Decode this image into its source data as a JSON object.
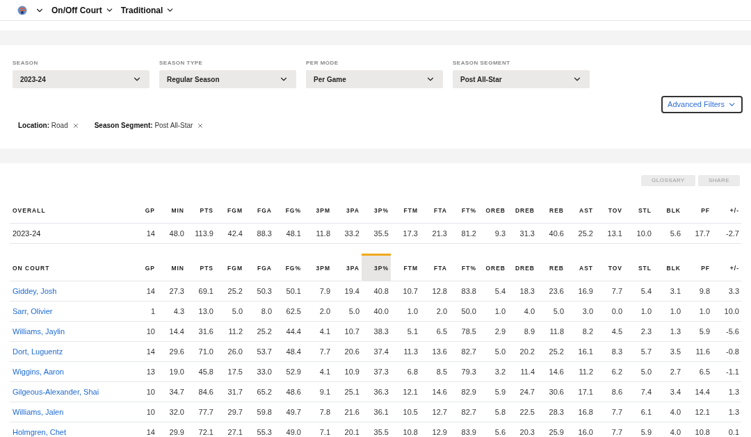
{
  "nav": {
    "items": [
      {
        "label": "On/Off Court"
      },
      {
        "label": "Traditional"
      }
    ]
  },
  "filters": {
    "dropdowns": [
      {
        "label": "SEASON",
        "value": "2023-24"
      },
      {
        "label": "SEASON TYPE",
        "value": "Regular Season"
      },
      {
        "label": "PER MODE",
        "value": "Per Game"
      },
      {
        "label": "SEASON SEGMENT",
        "value": "Post All-Star"
      }
    ],
    "advanced_button": "Advanced Filters",
    "tags": [
      {
        "label": "Location:",
        "value": "Road"
      },
      {
        "label": "Season Segment:",
        "value": "Post All-Star"
      }
    ]
  },
  "actions": [
    "GLOSSARY",
    "SHARE"
  ],
  "overall": {
    "columns": [
      {
        "label": "OVERALL",
        "selected": false
      },
      {
        "label": "GP",
        "selected": false
      },
      {
        "label": "MIN",
        "selected": false
      },
      {
        "label": "PTS",
        "selected": false
      },
      {
        "label": "FGM",
        "selected": false
      },
      {
        "label": "FGA",
        "selected": false
      },
      {
        "label": "FG%",
        "selected": false
      },
      {
        "label": "3PM",
        "selected": false
      },
      {
        "label": "3PA",
        "selected": false
      },
      {
        "label": "3P%",
        "selected": false
      },
      {
        "label": "FTM",
        "selected": false
      },
      {
        "label": "FTA",
        "selected": false
      },
      {
        "label": "FT%",
        "selected": false
      },
      {
        "label": "OREB",
        "selected": false
      },
      {
        "label": "DREB",
        "selected": false
      },
      {
        "label": "REB",
        "selected": false
      },
      {
        "label": "AST",
        "selected": false
      },
      {
        "label": "TOV",
        "selected": false
      },
      {
        "label": "STL",
        "selected": false
      },
      {
        "label": "BLK",
        "selected": false
      },
      {
        "label": "PF",
        "selected": false
      },
      {
        "label": "+/-",
        "selected": false
      }
    ],
    "rows": [
      [
        "2023-24",
        "14",
        "48.0",
        "113.9",
        "42.4",
        "88.3",
        "48.1",
        "11.8",
        "33.2",
        "35.5",
        "17.3",
        "21.3",
        "81.2",
        "9.3",
        "31.3",
        "40.6",
        "25.2",
        "13.1",
        "10.0",
        "5.6",
        "17.7",
        "-2.7"
      ]
    ]
  },
  "on_court": {
    "columns": [
      {
        "label": "ON COURT",
        "selected": false
      },
      {
        "label": "GP",
        "selected": false
      },
      {
        "label": "MIN",
        "selected": false
      },
      {
        "label": "PTS",
        "selected": false
      },
      {
        "label": "FGM",
        "selected": false
      },
      {
        "label": "FGA",
        "selected": false
      },
      {
        "label": "FG%",
        "selected": false
      },
      {
        "label": "3PM",
        "selected": false
      },
      {
        "label": "3PA",
        "selected": false
      },
      {
        "label": "3P%",
        "selected": true
      },
      {
        "label": "FTM",
        "selected": false
      },
      {
        "label": "FTA",
        "selected": false
      },
      {
        "label": "FT%",
        "selected": false
      },
      {
        "label": "OREB",
        "selected": false
      },
      {
        "label": "DREB",
        "selected": false
      },
      {
        "label": "REB",
        "selected": false
      },
      {
        "label": "AST",
        "selected": false
      },
      {
        "label": "TOV",
        "selected": false
      },
      {
        "label": "STL",
        "selected": false
      },
      {
        "label": "BLK",
        "selected": false
      },
      {
        "label": "PF",
        "selected": false
      },
      {
        "label": "+/-",
        "selected": false
      }
    ],
    "rows": [
      [
        "Giddey, Josh",
        "14",
        "27.3",
        "69.1",
        "25.2",
        "50.3",
        "50.1",
        "7.9",
        "19.4",
        "40.8",
        "10.7",
        "12.8",
        "83.8",
        "5.4",
        "18.3",
        "23.6",
        "16.9",
        "7.7",
        "5.4",
        "3.1",
        "9.8",
        "3.3"
      ],
      [
        "Sarr, Olivier",
        "1",
        "4.3",
        "13.0",
        "5.0",
        "8.0",
        "62.5",
        "2.0",
        "5.0",
        "40.0",
        "1.0",
        "2.0",
        "50.0",
        "1.0",
        "4.0",
        "5.0",
        "3.0",
        "0.0",
        "1.0",
        "1.0",
        "1.0",
        "10.0"
      ],
      [
        "Williams, Jaylin",
        "10",
        "14.4",
        "31.6",
        "11.2",
        "25.2",
        "44.4",
        "4.1",
        "10.7",
        "38.3",
        "5.1",
        "6.5",
        "78.5",
        "2.9",
        "8.9",
        "11.8",
        "8.2",
        "4.5",
        "2.3",
        "1.3",
        "5.9",
        "-5.6"
      ],
      [
        "Dort, Luguentz",
        "14",
        "29.6",
        "71.0",
        "26.0",
        "53.7",
        "48.4",
        "7.7",
        "20.6",
        "37.4",
        "11.3",
        "13.6",
        "82.7",
        "5.0",
        "20.2",
        "25.2",
        "16.1",
        "8.3",
        "5.7",
        "3.5",
        "11.6",
        "-0.8"
      ],
      [
        "Wiggins, Aaron",
        "13",
        "19.0",
        "45.8",
        "17.5",
        "33.0",
        "52.9",
        "4.1",
        "10.9",
        "37.3",
        "6.8",
        "8.5",
        "79.3",
        "3.2",
        "11.4",
        "14.6",
        "11.2",
        "6.2",
        "5.0",
        "2.7",
        "6.5",
        "-1.1"
      ],
      [
        "Gilgeous-Alexander, Shai",
        "10",
        "34.7",
        "84.6",
        "31.7",
        "65.2",
        "48.6",
        "9.1",
        "25.1",
        "36.3",
        "12.1",
        "14.6",
        "82.9",
        "5.9",
        "24.7",
        "30.6",
        "17.1",
        "8.6",
        "7.4",
        "3.4",
        "14.4",
        "1.3"
      ],
      [
        "Williams, Jalen",
        "10",
        "32.0",
        "77.7",
        "29.7",
        "59.8",
        "49.7",
        "7.8",
        "21.6",
        "36.1",
        "10.5",
        "12.7",
        "82.7",
        "5.8",
        "22.5",
        "28.3",
        "16.8",
        "7.7",
        "6.1",
        "4.0",
        "12.1",
        "1.3"
      ],
      [
        "Holmgren, Chet",
        "14",
        "29.9",
        "72.1",
        "27.1",
        "55.3",
        "49.0",
        "7.1",
        "20.1",
        "35.5",
        "10.8",
        "12.9",
        "83.9",
        "5.6",
        "20.3",
        "25.9",
        "16.0",
        "7.7",
        "5.9",
        "4.0",
        "10.8",
        "0.1"
      ]
    ]
  }
}
